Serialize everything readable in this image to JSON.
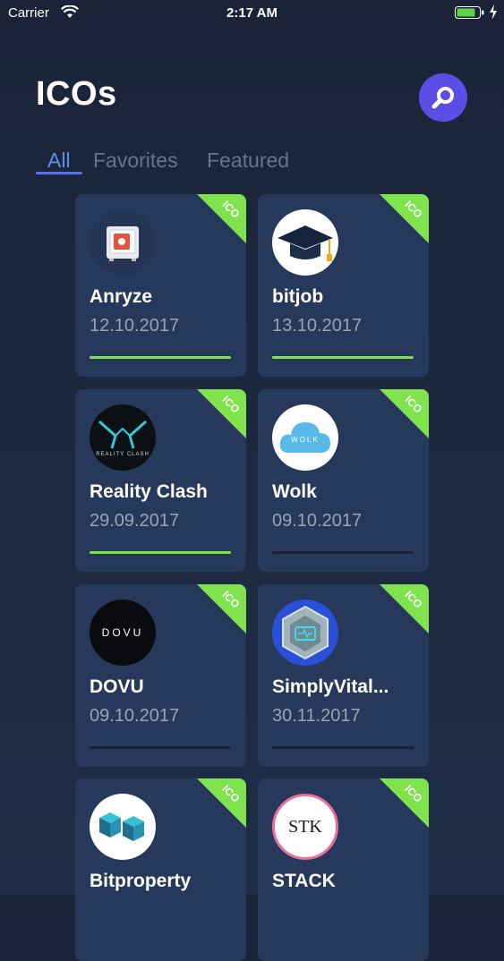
{
  "status_bar": {
    "carrier": "Carrier",
    "time": "2:17 AM"
  },
  "header": {
    "title": "ICOs",
    "search_icon": "search-icon"
  },
  "tabs": [
    {
      "label": "All",
      "active": true
    },
    {
      "label": "Favorites",
      "active": false
    },
    {
      "label": "Featured",
      "active": false
    }
  ],
  "colors": {
    "accent": "#5b4ee6",
    "ribbon": "#7ee34d",
    "card": "#27395a"
  },
  "cards": [
    {
      "name": "Anryze",
      "date": "12.10.2017",
      "badge": "ICO",
      "progress": 1.0
    },
    {
      "name": "bitjob",
      "date": "13.10.2017",
      "badge": "ICO",
      "progress": 1.0
    },
    {
      "name": "Reality Clash",
      "date": "29.09.2017",
      "badge": "ICO",
      "progress": 1.0,
      "logo_text": "REALITY CLASH"
    },
    {
      "name": "Wolk",
      "date": "09.10.2017",
      "badge": "ICO",
      "progress": 0.0,
      "logo_text": "WOLK"
    },
    {
      "name": "DOVU",
      "date": "09.10.2017",
      "badge": "ICO",
      "progress": 0.0,
      "logo_text": "DOVU"
    },
    {
      "name": "SimplyVital...",
      "date": "30.11.2017",
      "badge": "ICO",
      "progress": 0.0
    },
    {
      "name": "Bitproperty",
      "date": "",
      "badge": "ICO",
      "progress": 0.0
    },
    {
      "name": "STACK",
      "date": "",
      "badge": "ICO",
      "progress": 0.0,
      "logo_text": "STK"
    }
  ]
}
